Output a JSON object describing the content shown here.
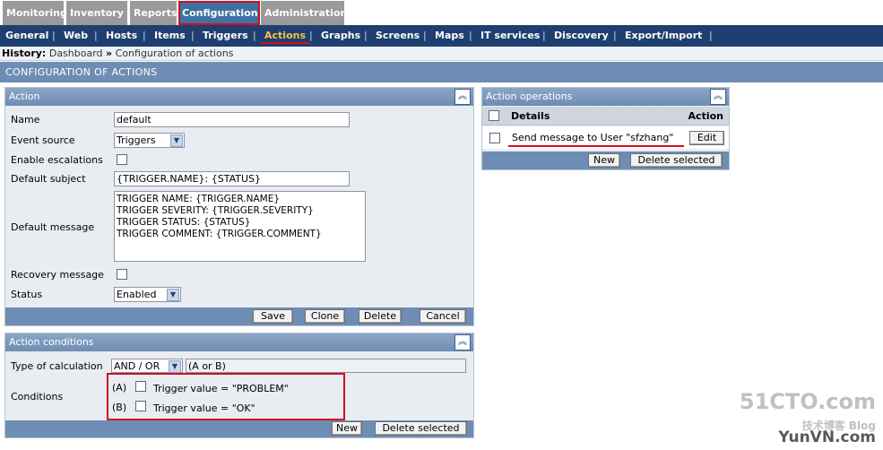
{
  "top_tabs": [
    "Monitoring",
    "Inventory",
    "Reports",
    "Configuration",
    "Administration"
  ],
  "sub_nav": [
    "General",
    "Web",
    "Hosts",
    "Items",
    "Triggers",
    "Actions",
    "Graphs",
    "Screens",
    "Maps",
    "IT services",
    "Discovery",
    "Export/Import"
  ],
  "history": {
    "label": "History:",
    "items": [
      "Dashboard",
      "Configuration of actions"
    ],
    "sep": "»"
  },
  "page_title": "CONFIGURATION OF ACTIONS",
  "action_panel": {
    "title": "Action",
    "fields": {
      "name_label": "Name",
      "name_value": "default",
      "event_source_label": "Event source",
      "event_source_value": "Triggers",
      "escalations_label": "Enable escalations",
      "subject_label": "Default subject",
      "subject_value": "{TRIGGER.NAME}: {STATUS}",
      "message_label": "Default message",
      "message_value": "TRIGGER NAME: {TRIGGER.NAME}\nTRIGGER SEVERITY: {TRIGGER.SEVERITY}\nTRIGGER STATUS: {STATUS}\nTRIGGER COMMENT: {TRIGGER.COMMENT}",
      "recovery_label": "Recovery message",
      "status_label": "Status",
      "status_value": "Enabled"
    },
    "buttons": {
      "save": "Save",
      "clone": "Clone",
      "delete": "Delete",
      "cancel": "Cancel"
    }
  },
  "conditions_panel": {
    "title": "Action conditions",
    "calc_label": "Type of calculation",
    "calc_value": "AND / OR",
    "calc_expr": "(A or B)",
    "conditions_label": "Conditions",
    "conditions": [
      {
        "letter": "(A)",
        "text": "Trigger value = \"PROBLEM\""
      },
      {
        "letter": "(B)",
        "text": "Trigger value = \"OK\""
      }
    ],
    "buttons": {
      "new": "New",
      "delete_selected": "Delete selected"
    }
  },
  "operations_panel": {
    "title": "Action operations",
    "col_details": "Details",
    "col_action": "Action",
    "row_text": "Send message to User \"sfzhang\"",
    "row_button": "Edit",
    "buttons": {
      "new": "New",
      "delete_selected": "Delete selected"
    }
  },
  "watermark": {
    "line1": "51CTO.com",
    "line2": "技术博客 Blog",
    "line3": "YunVN.com"
  }
}
